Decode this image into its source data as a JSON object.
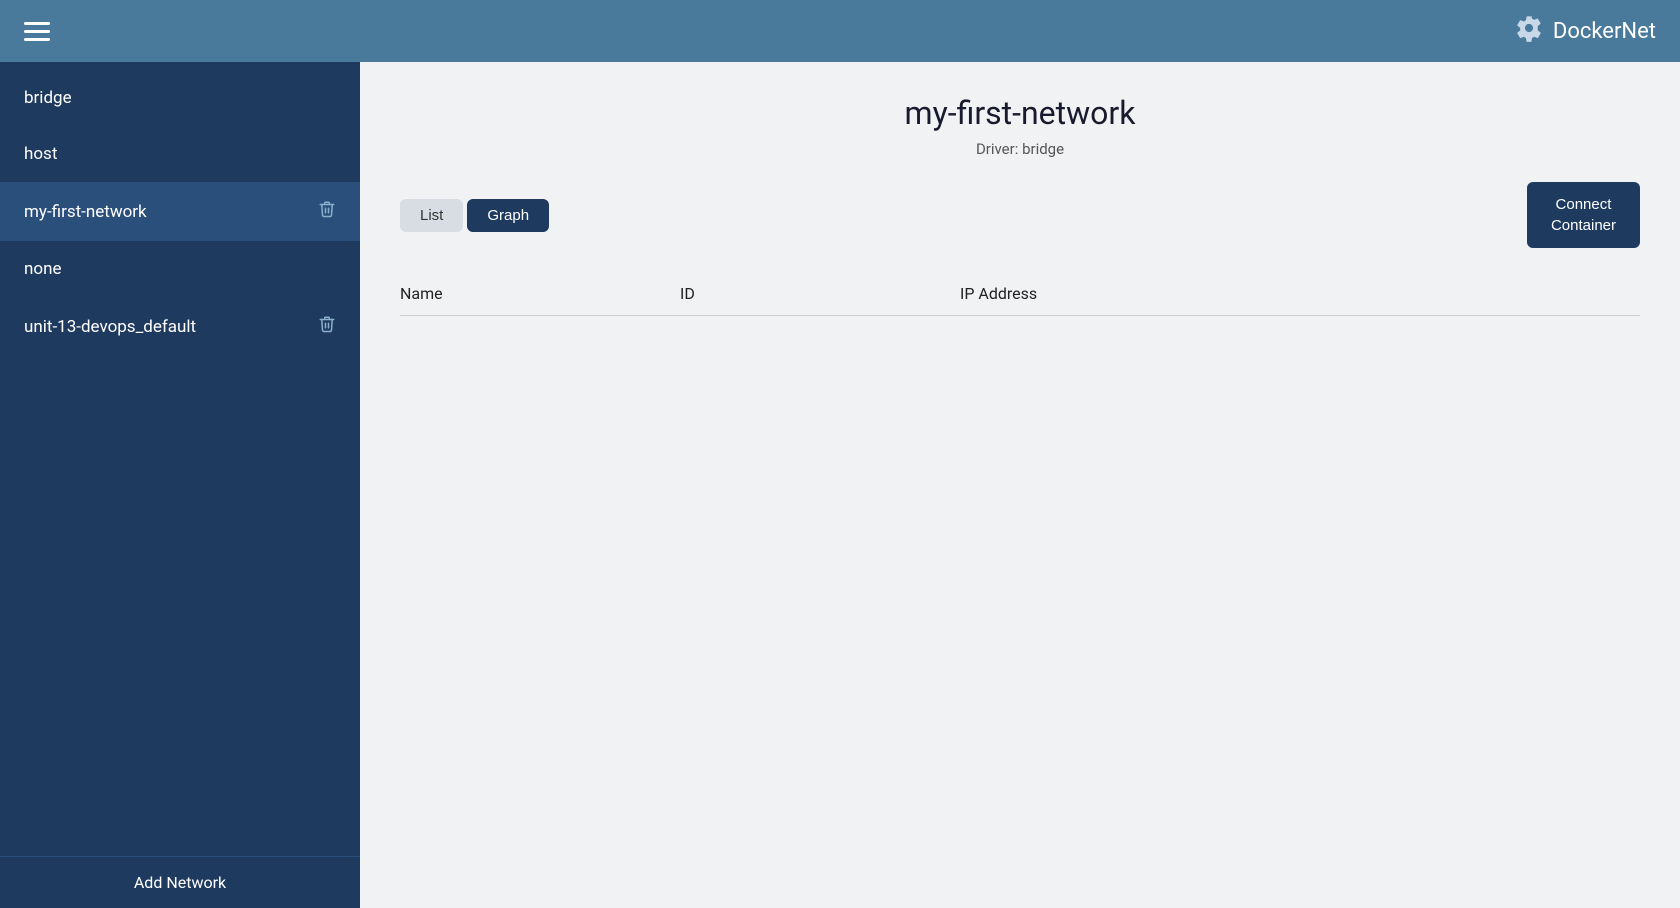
{
  "app": {
    "title": "DockerNet"
  },
  "navbar": {
    "menu_label": "Menu"
  },
  "sidebar": {
    "networks": [
      {
        "id": "bridge",
        "label": "bridge",
        "deletable": false
      },
      {
        "id": "host",
        "label": "host",
        "deletable": false
      },
      {
        "id": "my-first-network",
        "label": "my-first-network",
        "deletable": true,
        "active": true
      },
      {
        "id": "none",
        "label": "none",
        "deletable": false
      },
      {
        "id": "unit-13-devops_default",
        "label": "unit-13-devops_default",
        "deletable": true
      }
    ],
    "add_network_label": "Add Network"
  },
  "content": {
    "network_name": "my-first-network",
    "driver_label": "Driver: bridge",
    "tabs": [
      {
        "id": "list",
        "label": "List",
        "active": false
      },
      {
        "id": "graph",
        "label": "Graph",
        "active": true
      }
    ],
    "connect_button_label": "Connect\nContainer",
    "table": {
      "columns": [
        {
          "id": "name",
          "label": "Name"
        },
        {
          "id": "id",
          "label": "ID"
        },
        {
          "id": "ip",
          "label": "IP Address"
        }
      ],
      "rows": []
    }
  }
}
